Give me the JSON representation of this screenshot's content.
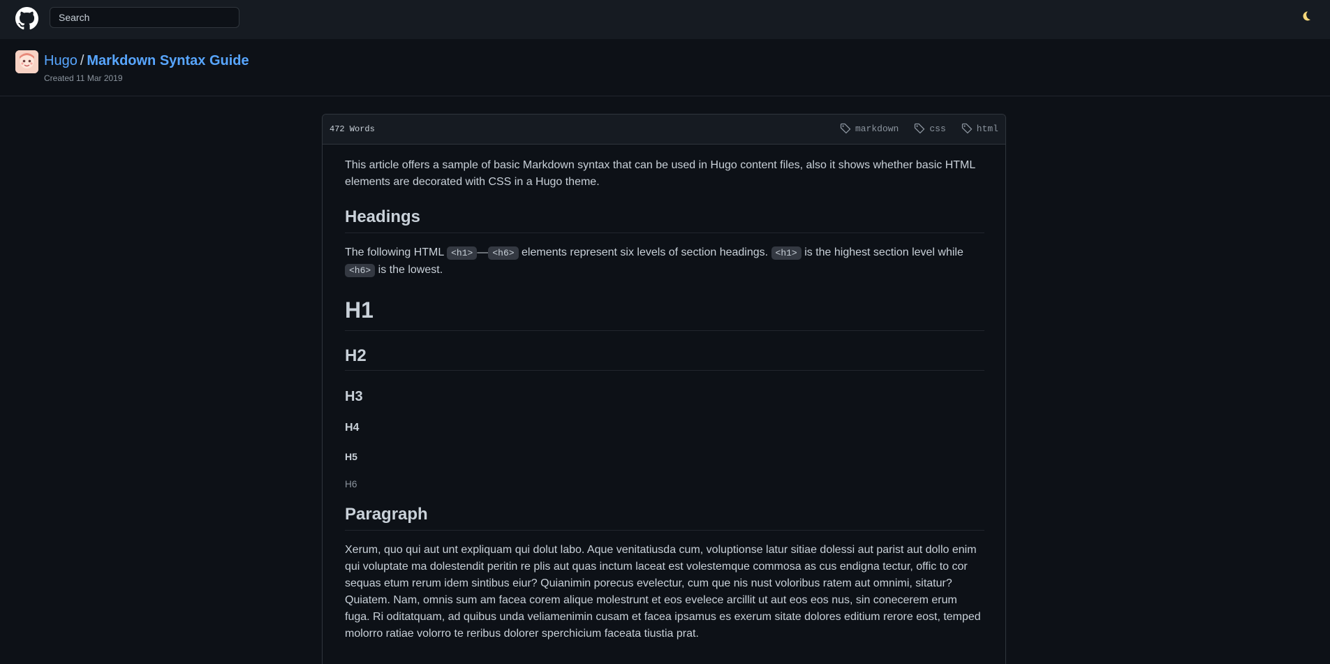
{
  "topbar": {
    "search_placeholder": "Search",
    "logo_icon": "github-logo-icon",
    "theme_icon": "moon-icon"
  },
  "repo": {
    "owner": "Hugo",
    "separator": "/",
    "title": "Markdown Syntax Guide",
    "created": "Created 11 Mar 2019"
  },
  "card": {
    "word_count": "472 Words",
    "tags": [
      "markdown",
      "css",
      "html"
    ]
  },
  "article": {
    "intro": "This article offers a sample of basic Markdown syntax that can be used in Hugo content files, also it shows whether basic HTML elements are decorated with CSS in a Hugo theme.",
    "headings_title": "Headings",
    "headings_text_1": "The following HTML ",
    "code_h1": "<h1>",
    "dash": "—",
    "code_h6": "<h6>",
    "headings_text_2": " elements represent six levels of section headings. ",
    "headings_text_3": " is the highest section level while ",
    "headings_text_4": " is the lowest.",
    "h1": "H1",
    "h2": "H2",
    "h3": "H3",
    "h4": "H4",
    "h5": "H5",
    "h6": "H6",
    "paragraph_title": "Paragraph",
    "paragraph_text": "Xerum, quo qui aut unt expliquam qui dolut labo. Aque venitatiusda cum, voluptionse latur sitiae dolessi aut parist aut dollo enim qui voluptate ma dolestendit peritin re plis aut quas inctum laceat est volestemque commosa as cus endigna tectur, offic to cor sequas etum rerum idem sintibus eiur? Quianimin porecus evelectur, cum que nis nust voloribus ratem aut omnimi, sitatur? Quiatem. Nam, omnis sum am facea corem alique molestrunt et eos evelece arcillit ut aut eos eos nus, sin conecerem erum fuga. Ri oditatquam, ad quibus unda veliamenimin cusam et facea ipsamus es exerum sitate dolores editium rerore eost, temped molorro ratiae volorro te reribus dolorer sperchicium faceata tiustia prat."
  },
  "colors": {
    "background": "#0d1117",
    "header": "#161b22",
    "link": "#58a6ff",
    "text": "#c9d1d9",
    "muted": "#8b949e"
  }
}
